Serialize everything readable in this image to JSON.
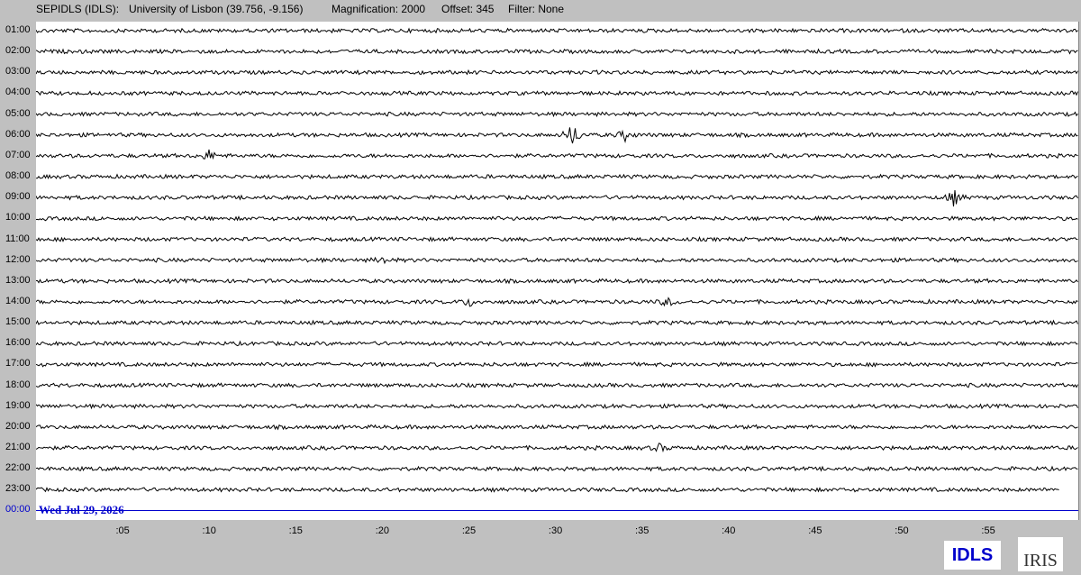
{
  "header": {
    "station": "SEPIDLS (IDLS):",
    "location": "University of Lisbon (39.756, -9.156)",
    "magnification": "Magnification: 2000",
    "offset": "Offset: 345",
    "filter": "Filter: None"
  },
  "helicorder": {
    "row_labels": [
      "01:00",
      "02:00",
      "03:00",
      "04:00",
      "05:00",
      "06:00",
      "07:00",
      "08:00",
      "09:00",
      "10:00",
      "11:00",
      "12:00",
      "13:00",
      "14:00",
      "15:00",
      "16:00",
      "17:00",
      "18:00",
      "19:00",
      "20:00",
      "21:00",
      "22:00",
      "23:00",
      "00:00"
    ],
    "minute_ticks": [
      ":05",
      ":10",
      ":15",
      ":20",
      ":25",
      ":30",
      ":35",
      ":40",
      ":45",
      ":50",
      ":55"
    ],
    "date": "Wed Jul 29, 2026",
    "trace_color": "#000000",
    "current_color": "#0000cc",
    "events": [
      {
        "row": 5,
        "minute": 31.0,
        "amp": 14
      },
      {
        "row": 5,
        "minute": 34.0,
        "amp": 6
      },
      {
        "row": 6,
        "minute": 10.0,
        "amp": 6
      },
      {
        "row": 8,
        "minute": 53.0,
        "amp": 9
      },
      {
        "row": 11,
        "minute": 20.0,
        "amp": 4
      },
      {
        "row": 13,
        "minute": 25.0,
        "amp": 5
      },
      {
        "row": 13,
        "minute": 36.5,
        "amp": 5
      },
      {
        "row": 20,
        "minute": 36.0,
        "amp": 4
      }
    ],
    "last_trace_end_minute": 59.1
  },
  "logos": {
    "idls": "IDLS",
    "iris": "IRIS"
  }
}
